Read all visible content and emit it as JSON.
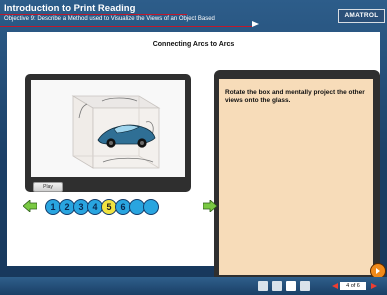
{
  "header": {
    "title": "Introduction to Print Reading",
    "subtitle": "Objective 9: Describe a Method used to Visualize the Views of an Object Based",
    "logo_text": "AMATROL"
  },
  "main": {
    "section_title": "Connecting Arcs to Arcs",
    "play_button": "Play",
    "instruction": "Rotate the box and mentally project the other views onto the glass."
  },
  "navigation": {
    "steps": [
      {
        "label": "1"
      },
      {
        "label": "2"
      },
      {
        "label": "3"
      },
      {
        "label": "4"
      },
      {
        "label": "5",
        "current": true
      },
      {
        "label": "6"
      },
      {
        "label": ""
      },
      {
        "label": ""
      }
    ]
  },
  "bottom_bar": {
    "page_counter": "4 of 6"
  },
  "colors": {
    "header_bg": "#1f476f",
    "accent_red": "#c0192d",
    "step_blue": "#29a5e0",
    "step_current": "#f1e341",
    "text_panel": "#f7dcb9",
    "nav_green": "#7ac943",
    "bottom_red": "#ee3d31"
  },
  "icons": {
    "left_arrow": "green-left-arrow-icon",
    "right_arrow": "green-right-arrow-icon",
    "home": "home-icon",
    "glossary": "glossary-icon",
    "print": "print-icon",
    "refresh": "refresh-icon",
    "previous": "previous-page-icon",
    "next": "next-page-icon",
    "sound": "sound-icon"
  }
}
